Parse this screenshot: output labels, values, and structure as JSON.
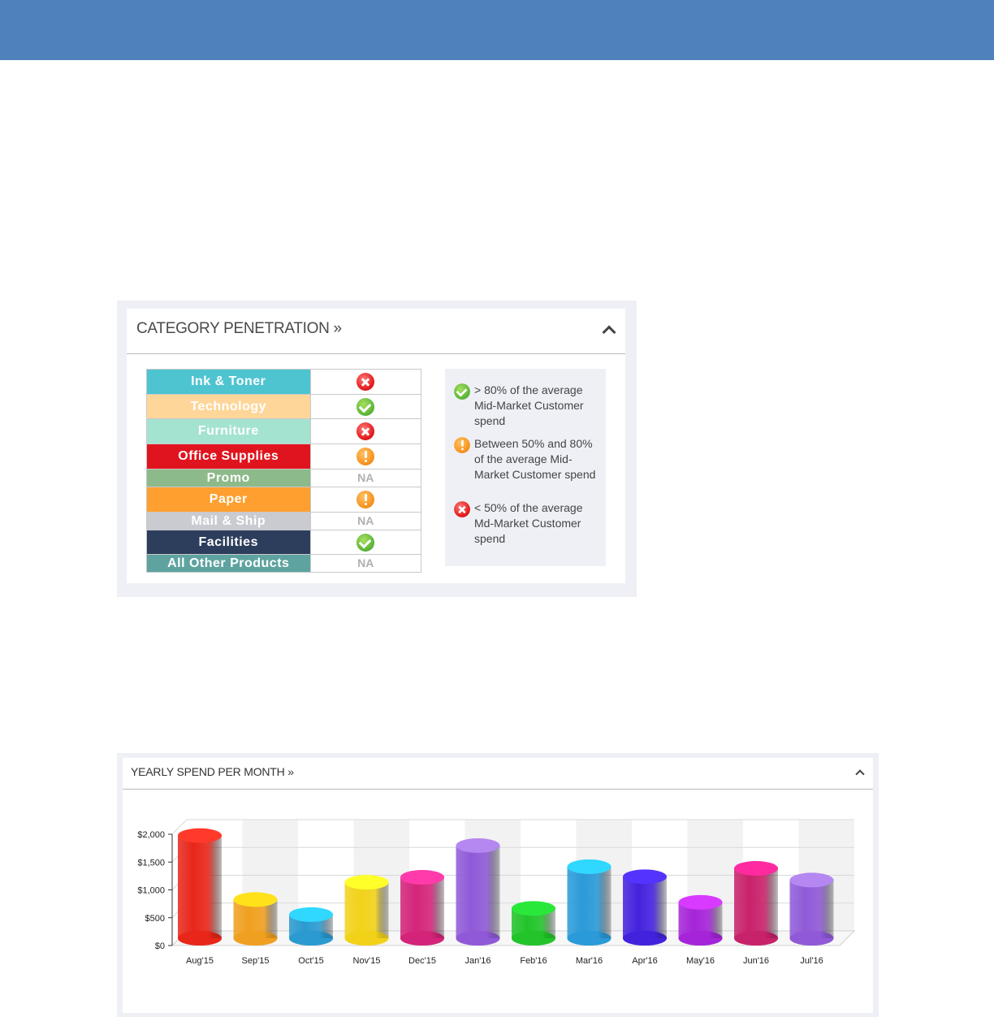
{
  "category_penetration": {
    "title": "CATEGORY PENETRATION »",
    "categories": [
      {
        "name": "Ink & Toner",
        "color": "#4fc4d1",
        "status": "x"
      },
      {
        "name": "Technology",
        "color": "#ffd699",
        "status": "ok"
      },
      {
        "name": "Furniture",
        "color": "#a5e3d1",
        "status": "x"
      },
      {
        "name": "Office Supplies",
        "color": "#e0141e",
        "status": "warn"
      },
      {
        "name": "Promo",
        "color": "#8cba8a",
        "status": "NA"
      },
      {
        "name": "Paper",
        "color": "#ff9f2f",
        "status": "warn"
      },
      {
        "name": "Mail & Ship",
        "color": "#c9cbd1",
        "status": "NA"
      },
      {
        "name": "Facilities",
        "color": "#2d3e5c",
        "status": "ok"
      },
      {
        "name": "All Other Products",
        "color": "#5ea3a0",
        "status": "NA"
      }
    ],
    "legend": [
      {
        "icon": "check-icon",
        "text": "> 80% of the average Mid-Market Customer spend"
      },
      {
        "icon": "exclamation-icon",
        "text": "Between 50% and 80% of the average Mid-Market Customer spend"
      },
      {
        "icon": "x-icon",
        "text": "< 50% of the average Md-Market Customer spend"
      }
    ]
  },
  "yearly_spend": {
    "title": "YEARLY SPEND PER MONTH »"
  },
  "chart_data": {
    "type": "bar",
    "categories": [
      "Aug'15",
      "Sep'15",
      "Oct'15",
      "Nov'15",
      "Dec'15",
      "Jan'16",
      "Feb'16",
      "Mar'16",
      "Apr'16",
      "May'16",
      "Jun'16",
      "Jul'16"
    ],
    "values": [
      2020,
      870,
      600,
      1180,
      1270,
      1840,
      710,
      1460,
      1280,
      820,
      1430,
      1220
    ],
    "colors": [
      "#e8261a",
      "#f0a020",
      "#2a9ad0",
      "#f2d21a",
      "#d4247a",
      "#8f5ad8",
      "#22c42a",
      "#2a9ad8",
      "#4422dd",
      "#a524d8",
      "#c8226a",
      "#8f5ad8"
    ],
    "top_colors": [
      "#ff3a2a",
      "#ffe21a",
      "#30d8ff",
      "#ffff2a",
      "#ff3aaa",
      "#b488f0",
      "#2ae83a",
      "#30d8ff",
      "#5533ff",
      "#d93aff",
      "#ff2aa0",
      "#b488f0"
    ],
    "ytick_labels": [
      "$0",
      "$500",
      "$1,000",
      "$1,500",
      "$2,000"
    ],
    "ylim": [
      0,
      2000
    ],
    "grid": true,
    "xlabel": "",
    "ylabel": "",
    "title": ""
  }
}
